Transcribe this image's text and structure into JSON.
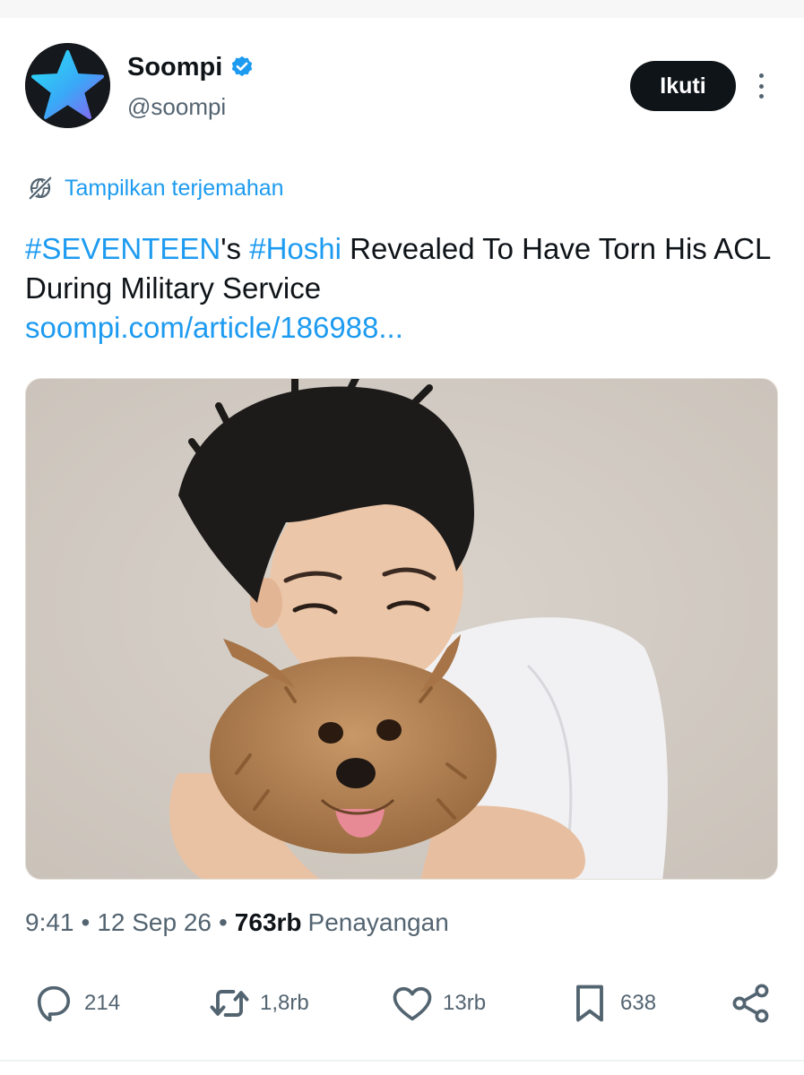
{
  "account": {
    "display_name": "Soompi",
    "handle": "@soompi",
    "follow_label": "Ikuti"
  },
  "translate_label": "Tampilkan terjemahan",
  "tweet": {
    "hashtag1": "#SEVENTEEN",
    "text_part1": "'s ",
    "hashtag2": "#Hoshi",
    "text_part2": " Revealed To Have Torn His ACL During Military Service",
    "link": "soompi.com/article/186988..."
  },
  "meta": {
    "time": "9:41",
    "separator": "•",
    "date": "12 Sep 26",
    "views_count": "763rb",
    "views_label": "Penayangan"
  },
  "actions": {
    "replies": "214",
    "reposts": "1,8rb",
    "likes": "13rb",
    "bookmarks": "638"
  },
  "colors": {
    "accent": "#1d9bf0",
    "text": "#0f1419",
    "muted": "#536471",
    "follow_bg": "#0f1419"
  },
  "icons": [
    "star-logo-icon",
    "verified-badge-icon",
    "more-icon",
    "translate-icon",
    "reply-icon",
    "repost-icon",
    "like-icon",
    "bookmark-icon",
    "share-icon"
  ]
}
